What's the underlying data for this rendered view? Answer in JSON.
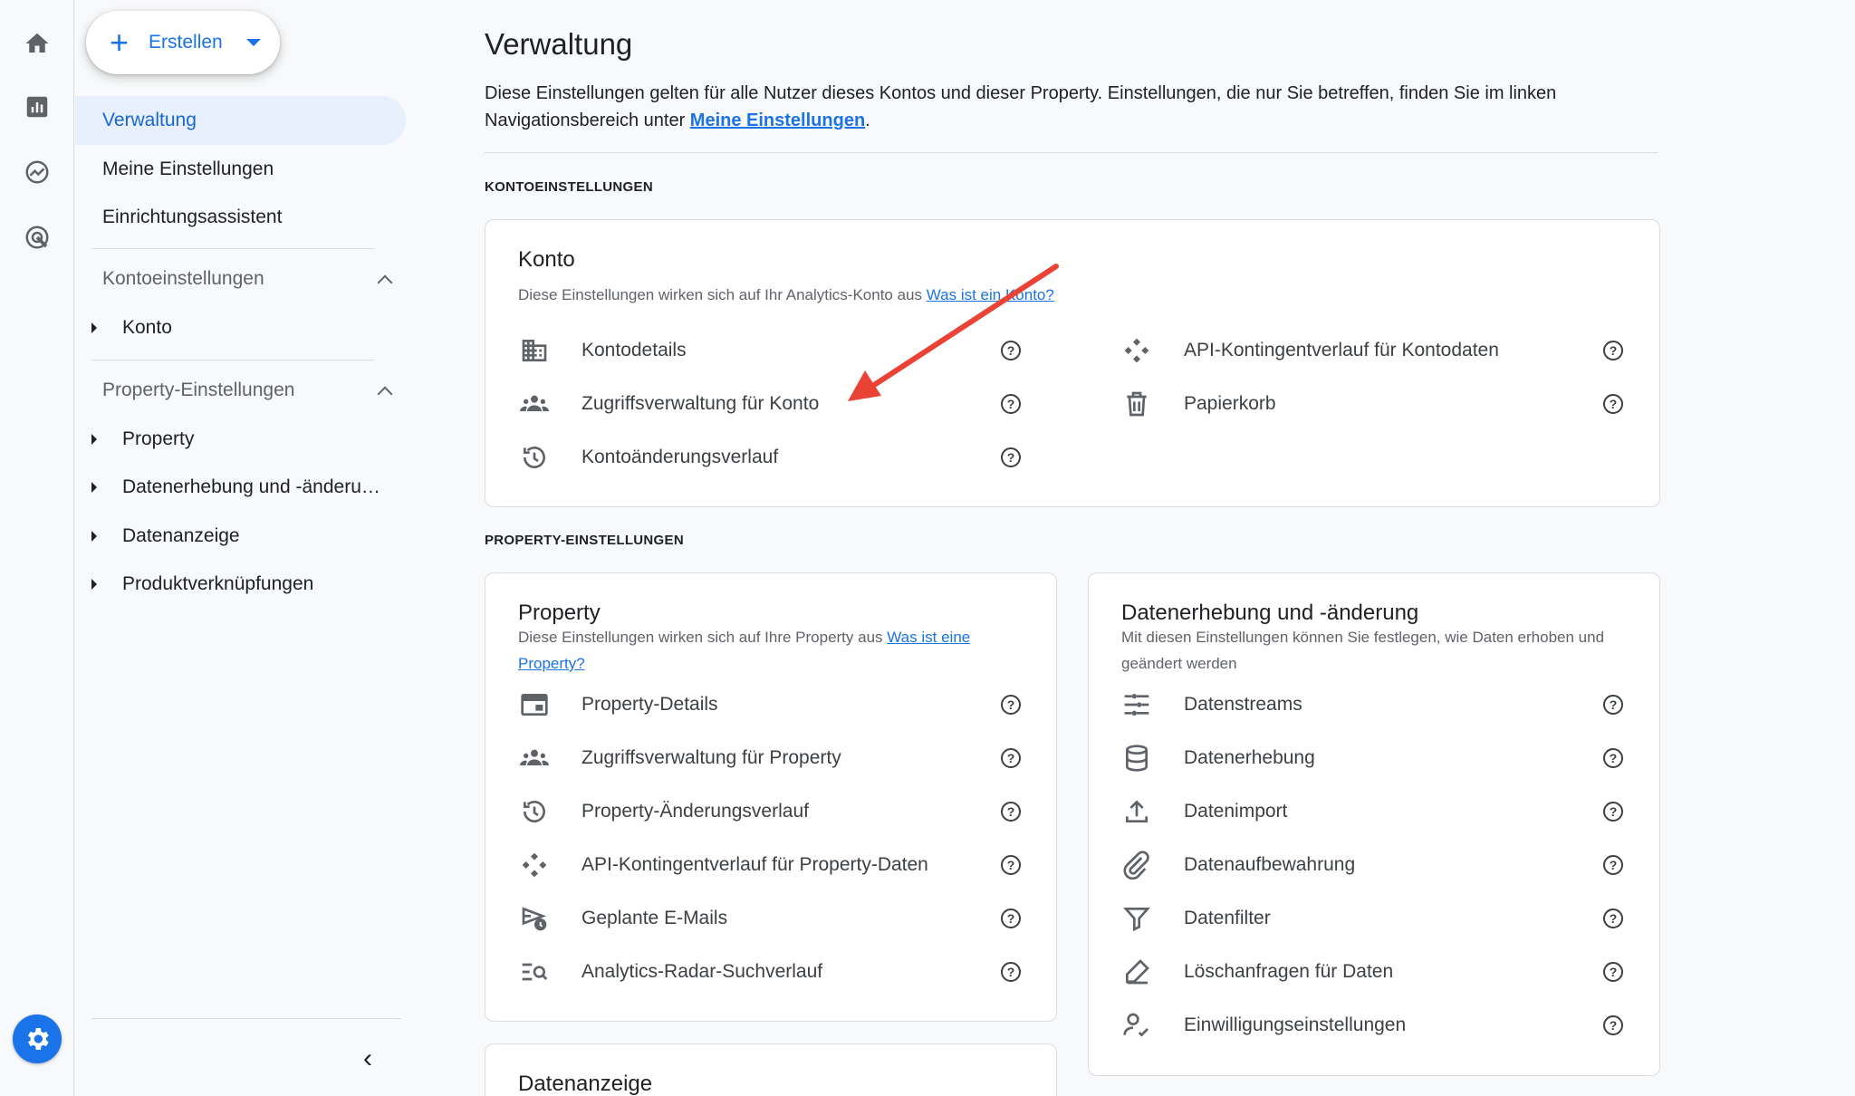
{
  "create": {
    "label": "Erstellen"
  },
  "nav": {
    "verwaltung": "Verwaltung",
    "meine": "Meine Einstellungen",
    "assistent": "Einrichtungsassistent",
    "konto_section": "Kontoeinstellungen",
    "konto": "Konto",
    "property_section": "Property-Einstellungen",
    "property": "Property",
    "datenerhebung": "Datenerhebung und -änderu…",
    "datenanzeige": "Datenanzeige",
    "produkt": "Produktverknüpfungen"
  },
  "main": {
    "title": "Verwaltung",
    "desc_1": "Diese Einstellungen gelten für alle Nutzer dieses Kontos und dieser Property. Einstellungen, die nur Sie betreffen, finden Sie im linken Navigationsbereich unter ",
    "desc_link": "Meine Einstellungen",
    "desc_end": ".",
    "konto_label": "KONTOEINSTELLUNGEN",
    "property_label": "PROPERTY-EINSTELLUNGEN"
  },
  "konto_card": {
    "title": "Konto",
    "sub": "Diese Einstellungen wirken sich auf Ihr Analytics-Konto aus ",
    "sub_link": "Was ist ein Konto?",
    "left": [
      "Kontodetails",
      "Zugriffsverwaltung für Konto",
      "Kontoänderungsverlauf"
    ],
    "right": [
      "API-Kontingentverlauf für Kontodaten",
      "Papierkorb"
    ]
  },
  "property_card": {
    "title": "Property",
    "sub": "Diese Einstellungen wirken sich auf Ihre Property aus ",
    "sub_link": "Was ist eine Property?",
    "items": [
      "Property-Details",
      "Zugriffsverwaltung für Property",
      "Property-Änderungsverlauf",
      "API-Kontingentverlauf für Property-Daten",
      "Geplante E-Mails",
      "Analytics-Radar-Suchverlauf"
    ]
  },
  "daten_card": {
    "title": "Datenerhebung und -änderung",
    "sub": "Mit diesen Einstellungen können Sie festlegen, wie Daten erhoben und geändert werden",
    "items": [
      "Datenstreams",
      "Datenerhebung",
      "Datenimport",
      "Datenaufbewahrung",
      "Datenfilter",
      "Löschanfragen für Daten",
      "Einwilligungseinstellungen"
    ]
  },
  "anzeige_card": {
    "title": "Datenanzeige"
  },
  "help_glyph": "?",
  "colors": {
    "accent": "#1a73e8",
    "active_bg": "#e8f0fe",
    "annotation": "#ea4335"
  }
}
